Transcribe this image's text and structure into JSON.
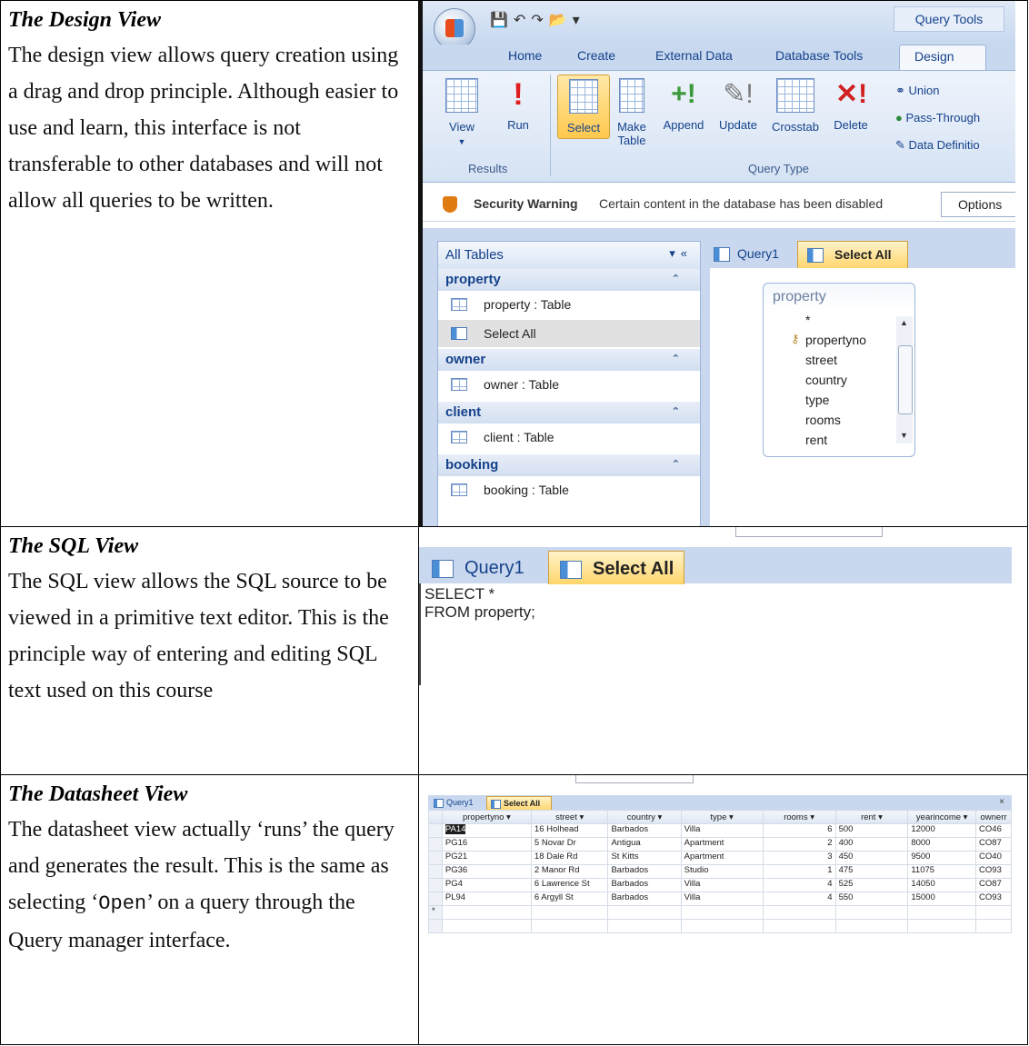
{
  "design_section": {
    "heading": "The Design View",
    "body": "The design view allows query creation using a drag and drop principle. Although easier to use and learn, this interface is not transferable to other databases and will not allow all queries to be written."
  },
  "sql_section": {
    "heading": "The SQL View",
    "body": "The SQL view allows the SQL source to be viewed in a primitive text editor. This is the principle way of entering and editing SQL text used on this course"
  },
  "datasheet_section": {
    "heading": "The Datasheet View",
    "body_before": "The datasheet view actually ‘runs’ the query and generates the result. This is the same as selecting ‘",
    "body_code": "Open",
    "body_after": "’ on a query through the Query manager interface."
  },
  "access_design": {
    "contextual_label": "Query Tools",
    "tabs": [
      "Home",
      "Create",
      "External Data",
      "Database Tools",
      "Design"
    ],
    "ribbon": {
      "view": "View",
      "run": "Run",
      "select": "Select",
      "make_table_1": "Make",
      "make_table_2": "Table",
      "append": "Append",
      "update": "Update",
      "crosstab": "Crosstab",
      "delete": "Delete",
      "union": "Union",
      "pass_through": "Pass-Through",
      "data_definition": "Data Definitio",
      "group_results": "Results",
      "group_query_type": "Query Type"
    },
    "security": {
      "title": "Security Warning",
      "message": "Certain content in the database has been disabled",
      "options": "Options"
    },
    "nav": {
      "header": "All Tables",
      "groups": [
        {
          "name": "property",
          "items": [
            "property : Table",
            "Select All"
          ]
        },
        {
          "name": "owner",
          "items": [
            "owner : Table"
          ]
        },
        {
          "name": "client",
          "items": [
            "client : Table"
          ]
        },
        {
          "name": "booking",
          "items": [
            "booking : Table"
          ]
        }
      ]
    },
    "query_tabs": [
      "Query1",
      "Select All"
    ],
    "table_box": {
      "name": "property",
      "fields": [
        "*",
        "propertyno",
        "street",
        "country",
        "type",
        "rooms",
        "rent"
      ]
    }
  },
  "access_sql": {
    "query_tabs": [
      "Query1",
      "Select All"
    ],
    "sql_text": "SELECT *\nFROM property;"
  },
  "access_datasheet": {
    "query_tabs": [
      "Query1",
      "Select All"
    ],
    "close": "×",
    "columns": [
      "propertyno",
      "street",
      "country",
      "type",
      "rooms",
      "rent",
      "yearincome",
      "ownerr"
    ],
    "rows": [
      [
        "PA14",
        "16 Holhead",
        "Barbados",
        "Villa",
        "6",
        "500",
        "12000",
        "CO46"
      ],
      [
        "PG16",
        "5 Novar Dr",
        "Antigua",
        "Apartment",
        "2",
        "400",
        "8000",
        "CO87"
      ],
      [
        "PG21",
        "18 Dale Rd",
        "St Kitts",
        "Apartment",
        "3",
        "450",
        "9500",
        "CO40"
      ],
      [
        "PG36",
        "2 Manor Rd",
        "Barbados",
        "Studio",
        "1",
        "475",
        "11075",
        "CO93"
      ],
      [
        "PG4",
        "6 Lawrence St",
        "Barbados",
        "Villa",
        "4",
        "525",
        "14050",
        "CO87"
      ],
      [
        "PL94",
        "6 Argyll St",
        "Barbados",
        "Villa",
        "4",
        "550",
        "15000",
        "CO93"
      ]
    ],
    "new_row_marker": "*"
  }
}
